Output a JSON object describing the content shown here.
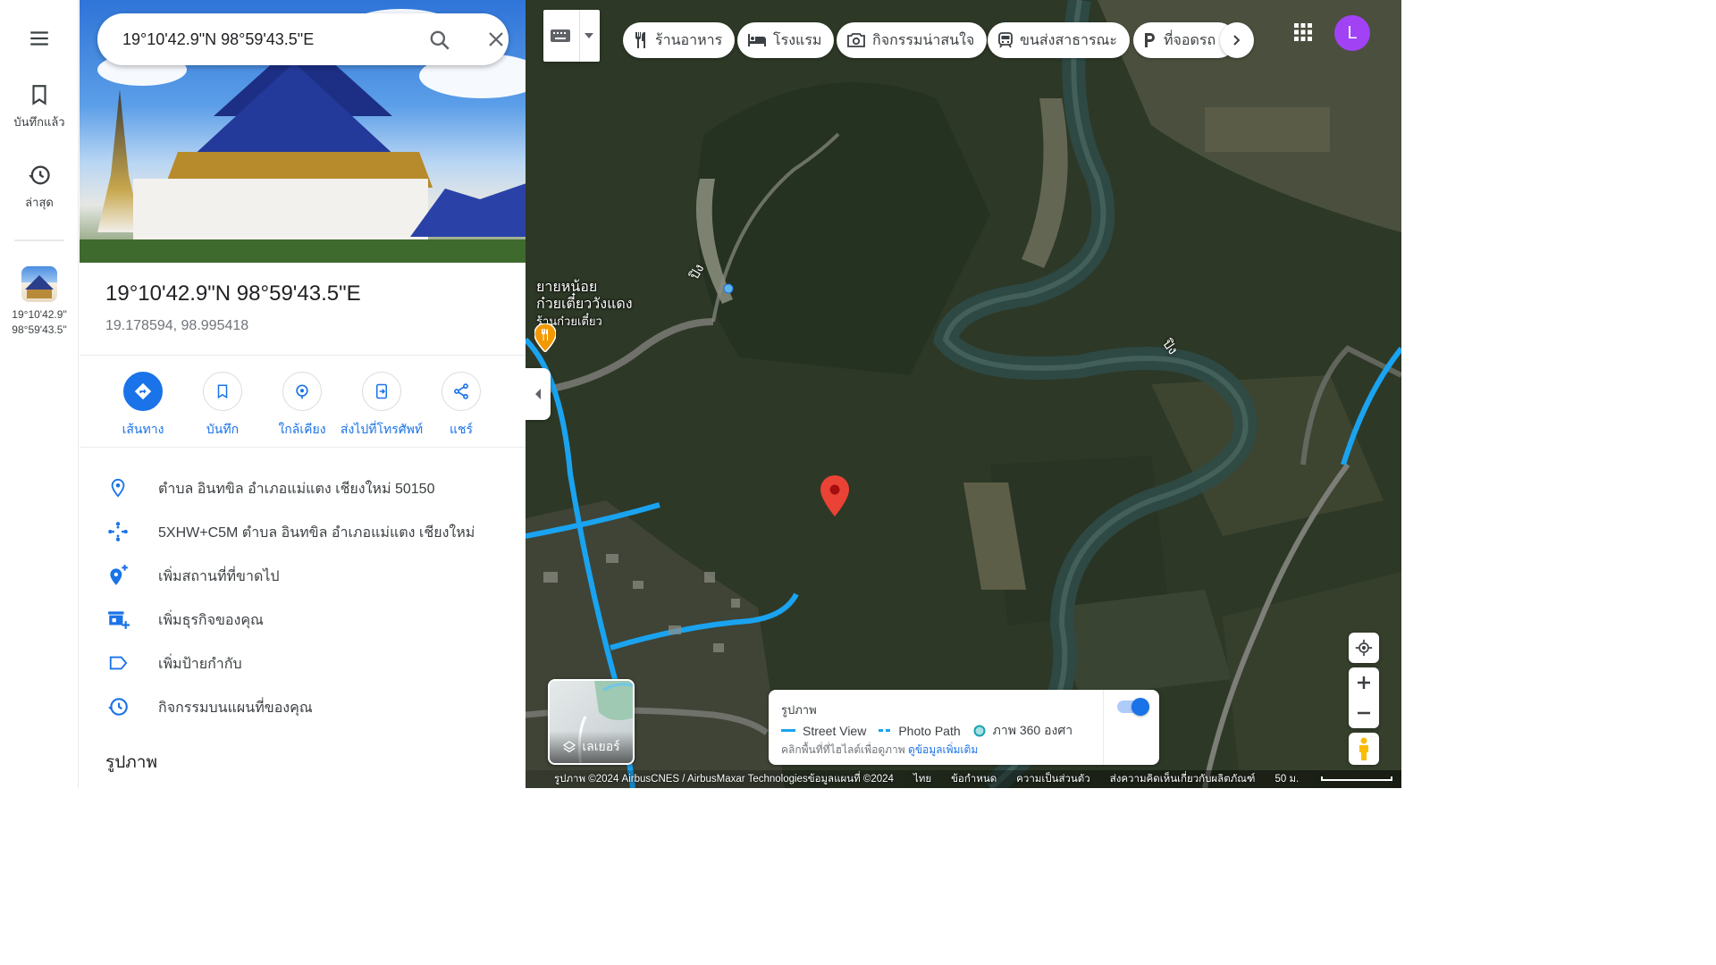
{
  "rail": {
    "saved_label": "บันทึกแล้ว",
    "recent_label": "ล่าสุด",
    "recent_place": {
      "line1": "19°10'42.9\"",
      "line2": "98°59'43.5\""
    }
  },
  "search": {
    "value": "19°10'42.9\"N 98°59'43.5\"E",
    "icon": "search-icon",
    "clear_icon": "close-icon"
  },
  "place": {
    "title": "19°10'42.9\"N 98°59'43.5\"E",
    "coordinates": "19.178594, 98.995418"
  },
  "actions": [
    {
      "label": "เส้นทาง",
      "icon": "directions-icon"
    },
    {
      "label": "บันทึก",
      "icon": "bookmark-icon"
    },
    {
      "label": "ใกล้เคียง",
      "icon": "nearby-icon"
    },
    {
      "label": "ส่งไปที่โทรศัพท์",
      "icon": "send-to-phone-icon"
    },
    {
      "label": "แชร์",
      "icon": "share-icon"
    }
  ],
  "info": [
    {
      "text": "ตำบล อินทขิล อำเภอแม่แตง เชียงใหม่ 50150",
      "icon": "location-pin-icon"
    },
    {
      "text": "5XHW+C5M ตำบล อินทขิล อำเภอแม่แตง เชียงใหม่",
      "icon": "plus-code-icon"
    },
    {
      "text": "เพิ่มสถานที่ที่ขาดไป",
      "icon": "add-place-icon"
    },
    {
      "text": "เพิ่มธุรกิจของคุณ",
      "icon": "add-business-icon"
    },
    {
      "text": "เพิ่มป้ายกำกับ",
      "icon": "label-icon"
    },
    {
      "text": "กิจกรรมบนแผนที่ของคุณ",
      "icon": "history-icon"
    }
  ],
  "photos_heading": "รูปภาพ",
  "chips": [
    {
      "label": "ร้านอาหาร",
      "icon": "restaurant-icon"
    },
    {
      "label": "โรงแรม",
      "icon": "hotel-icon"
    },
    {
      "label": "กิจกรรมน่าสนใจ",
      "icon": "camera-icon"
    },
    {
      "label": "ขนส่งสาธารณะ",
      "icon": "transit-icon"
    },
    {
      "label": "ที่จอดรถ",
      "icon": "parking-icon"
    }
  ],
  "avatar_letter": "L",
  "map": {
    "poi_name_line1": "ยายหน้อย",
    "poi_name_line2": "ก๋วยเตี๋ยววังแดง",
    "poi_category": "ร้านก๋วยเตี๋ยว",
    "river_label": "ปิง"
  },
  "layers_label": "เลเยอร์",
  "legend": {
    "title": "รูปภาพ",
    "street_view": "Street View",
    "photo_path": "Photo Path",
    "photo_360": "ภาพ 360 องศา",
    "hint": "คลิกพื้นที่ที่ไฮไลต์เพื่อดูภาพ",
    "more_link": "ดูข้อมูลเพิ่มเติม",
    "toggle_on": true
  },
  "footer": {
    "imagery": "รูปภาพ ©2024 AirbusCNES / AirbusMaxar Technologiesข้อมูลแผนที่ ©2024",
    "language": "ไทย",
    "terms": "ข้อกำหนด",
    "privacy": "ความเป็นส่วนตัว",
    "feedback": "ส่งความคิดเห็นเกี่ยวกับผลิตภัณฑ์",
    "scale": "50 ม."
  },
  "colors": {
    "accent": "#1a73e8",
    "pin": "#ea4335",
    "avatar": "#a142f4",
    "street_view_line": "#1aa3f0"
  }
}
